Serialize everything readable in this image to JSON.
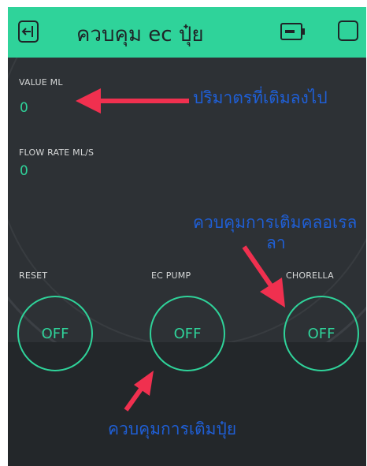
{
  "header": {
    "title": "ควบคุม ec ปุ๋ย",
    "back_icon": "exit-icon",
    "battery_icon": "battery-icon",
    "window_icon": "square-icon"
  },
  "displays": {
    "value_ml": {
      "label": "VALUE ML",
      "value": "0"
    },
    "flow_rate": {
      "label": "FLOW RATE ML/S",
      "value": "0"
    }
  },
  "buttons": {
    "reset": {
      "label": "RESET",
      "state": "OFF"
    },
    "ec_pump": {
      "label": "EC PUMP",
      "state": "OFF"
    },
    "chorella": {
      "label": "CHORELLA",
      "state": "OFF"
    }
  },
  "annotations": {
    "volume_added": "ปริมาตรที่เติมลงไป",
    "chlorella_line1": "ควบคุมการเติมคลอเรล",
    "chlorella_line2": "ลา",
    "fertilizer": "ควบคุมการเติมปุ๋ย"
  },
  "colors": {
    "accent": "#2fd39a",
    "background": "#2d3135",
    "annotation_text": "#1f5fd6",
    "arrow": "#f0304f"
  }
}
